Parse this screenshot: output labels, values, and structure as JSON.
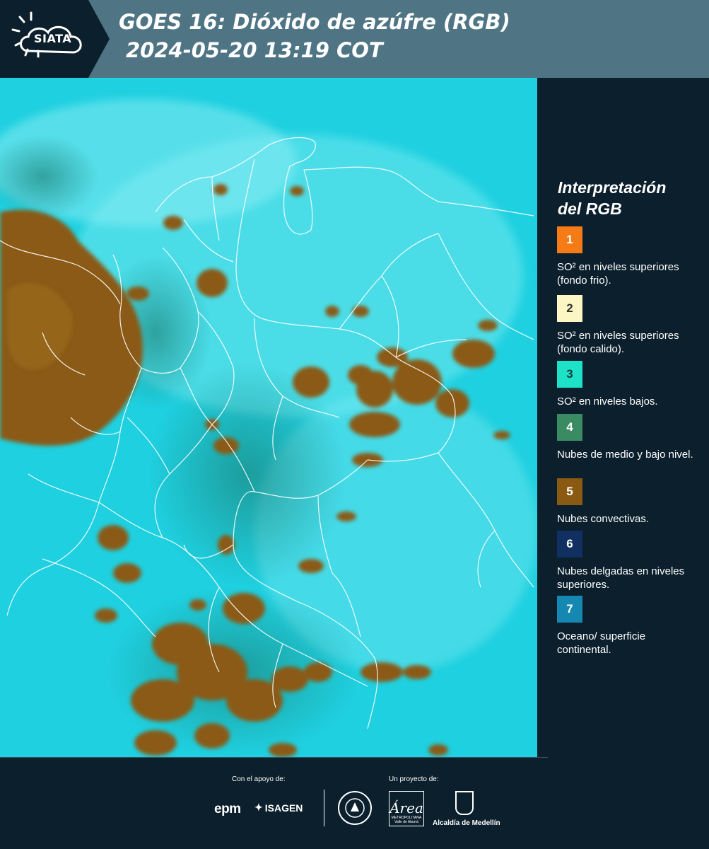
{
  "header": {
    "logo_text": "SIATA",
    "title_line1": "GOES 16: Dióxido de azúfre (RGB)",
    "title_line2": "2024-05-20 13:19 COT"
  },
  "legend": {
    "title_line1": "Interpretación",
    "title_line2": "del RGB",
    "items": [
      {
        "number": "1",
        "color": "#f47b16",
        "num_color": "#ffffff",
        "text": "SO² en niveles superiores (fondo frio)."
      },
      {
        "number": "2",
        "color": "#fcf5c4",
        "num_color": "#333333",
        "text": "SO² en niveles superiores (fondo calido)."
      },
      {
        "number": "3",
        "color": "#1de2c8",
        "num_color": "#0b3d3d",
        "text": "SO² en niveles bajos."
      },
      {
        "number": "4",
        "color": "#3a8b62",
        "num_color": "#ffffff",
        "text": "Nubes de medio y bajo nivel."
      },
      {
        "number": "5",
        "color": "#8a5a12",
        "num_color": "#ffffff",
        "text": "Nubes convectivas."
      },
      {
        "number": "6",
        "color": "#0f3061",
        "num_color": "#ffffff",
        "text": "Nubes delgadas en niveles superiores."
      },
      {
        "number": "7",
        "color": "#1488b0",
        "num_color": "#ffffff",
        "text": "Oceano/ superficie continental."
      }
    ]
  },
  "footer": {
    "support_label": "Con el apoyo de:",
    "project_label": "Un proyecto de:",
    "epm": "epm",
    "isagen": "ISAGEN",
    "area_big": "Área",
    "area_small1": "METROPOLITANA",
    "area_small2": "Valle de Aburrá",
    "alcaldia": "Alcaldía de Medellín"
  },
  "colors": {
    "background": "#0b1f2c",
    "header": "#4f7585",
    "map_base": "#1fd0e0",
    "convective": "#8a5a12"
  }
}
